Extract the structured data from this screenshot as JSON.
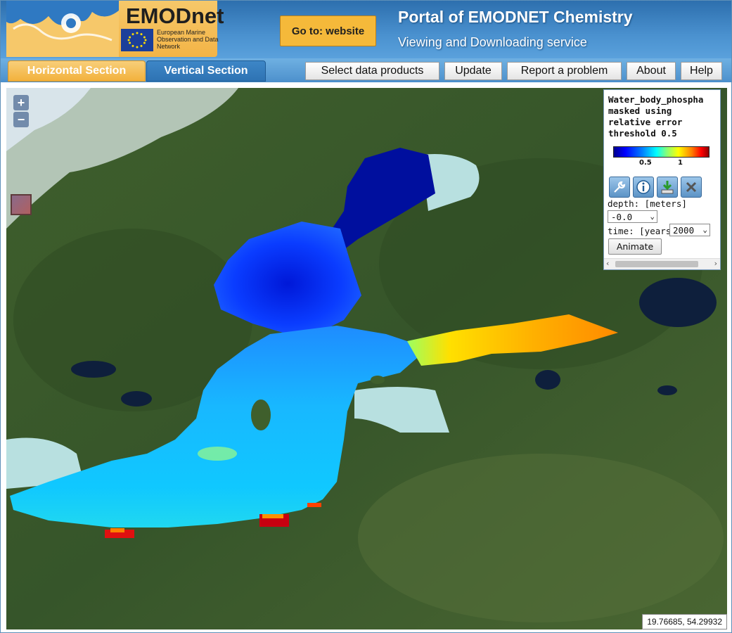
{
  "header": {
    "brand_name": "EMODnet",
    "brand_sub": "European Marine Observation and Data Network",
    "goto_button": "Go to: website",
    "portal_title": "Portal of EMODNET Chemistry",
    "portal_subtitle": "Viewing and Downloading service"
  },
  "nav": {
    "tab_horizontal": "Horizontal Section",
    "tab_vertical": "Vertical Section",
    "buttons": [
      "Select data products",
      "Update",
      "Report a problem",
      "About",
      "Help"
    ]
  },
  "map": {
    "zoom_in": "+",
    "zoom_out": "−",
    "coordinates": "19.76685, 54.29932"
  },
  "legend": {
    "title_lines": [
      "Water_body_phospha",
      "masked using",
      "relative error",
      "threshold 0.5"
    ],
    "colorbar_ticks": [
      "0.5",
      "1"
    ],
    "depth_label": "depth: [meters]",
    "depth_value": "-0.0",
    "time_label": "time: [years]",
    "time_value": "2000",
    "animate": "Animate",
    "tools": [
      "wrench-icon",
      "info-icon",
      "download-icon",
      "close-icon"
    ]
  },
  "colors": {
    "header_blue": "#3a80c0",
    "accent_orange": "#f5b93a",
    "tab_active": "#f2b13c"
  }
}
